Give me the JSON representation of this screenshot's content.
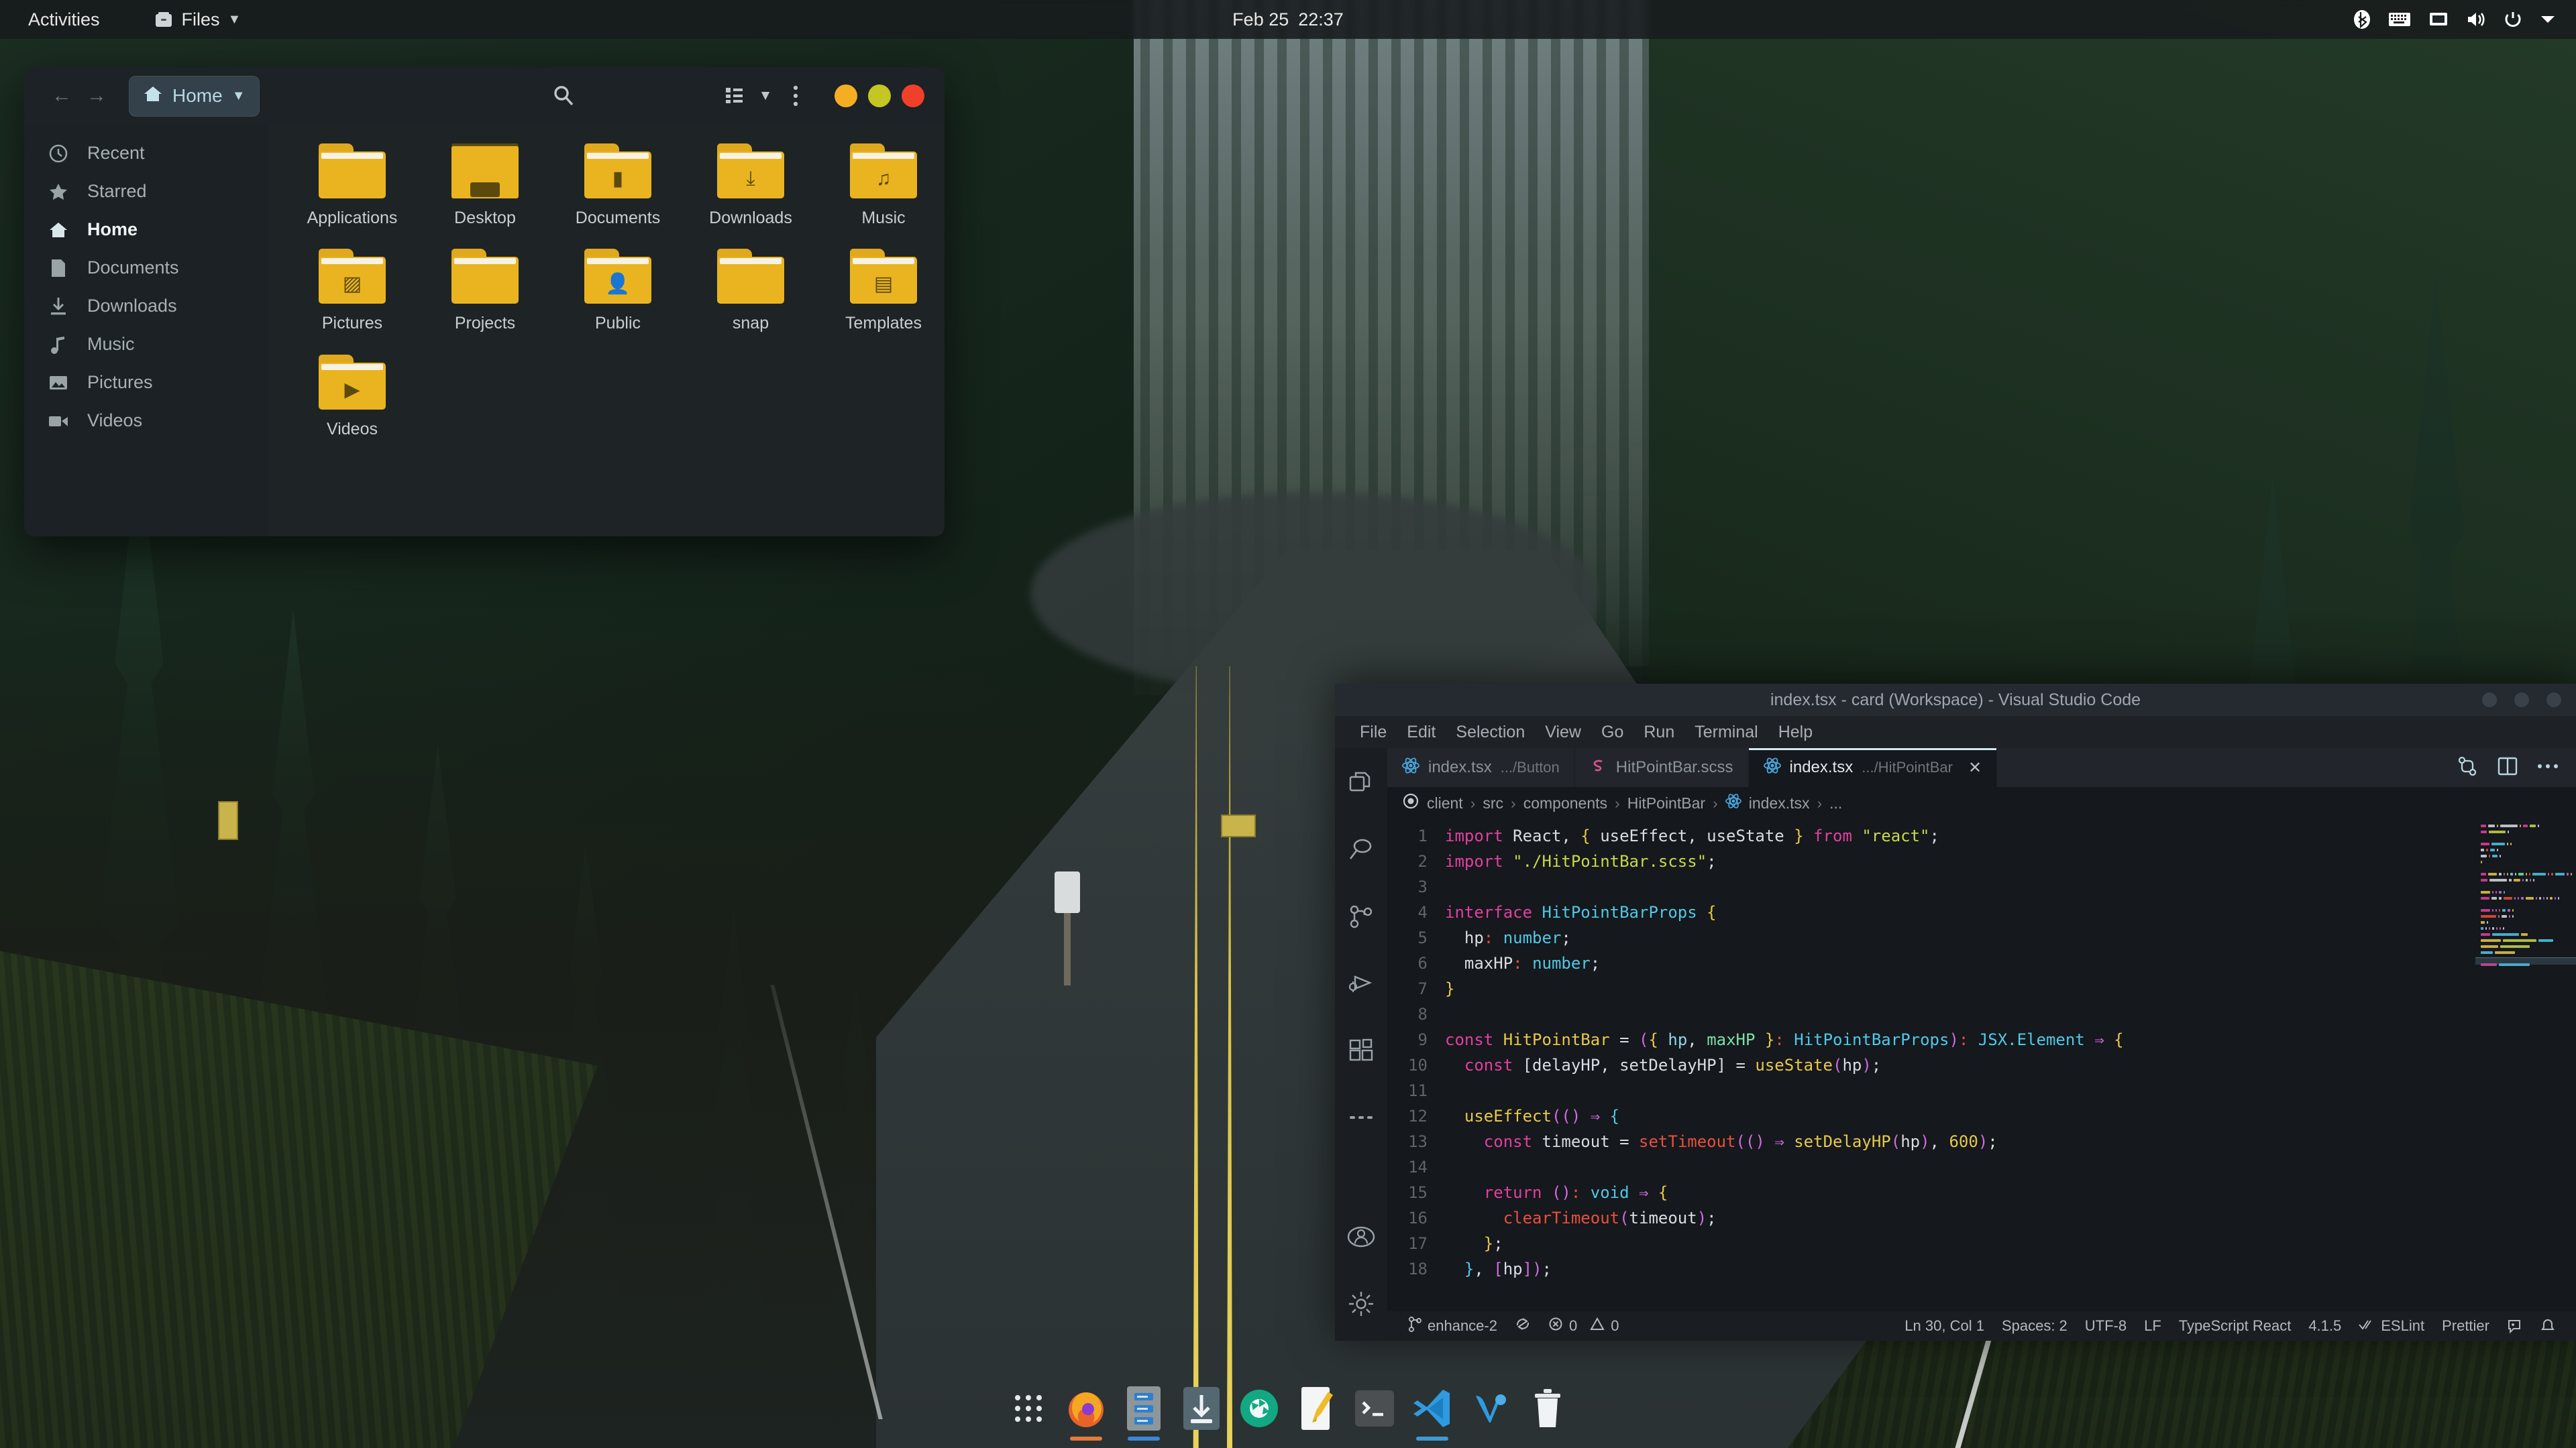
{
  "topbar": {
    "activities": "Activities",
    "app_name": "Files",
    "app_icon": "files-icon",
    "app_menu_arrow": "▼",
    "clock_date": "Feb 25",
    "clock_time": "22:37",
    "tray_icons": [
      "bluetooth-icon",
      "keyboard-icon",
      "display-icon",
      "volume-icon",
      "power-icon",
      "chevron-down-icon"
    ]
  },
  "files_window": {
    "header": {
      "back_arrow": "←",
      "forward_arrow": "→",
      "path_label": "Home",
      "path_home_icon": "home-icon",
      "path_dropdown": "▼",
      "search_icon": "search-icon",
      "view_icon": "list-view-icon",
      "view_dropdown": "▼",
      "menu_icon": "kebab-menu-icon",
      "window_controls": [
        {
          "name": "minimize-button",
          "color": "#f5ad23"
        },
        {
          "name": "maximize-button",
          "color": "#c3c623"
        },
        {
          "name": "close-button",
          "color": "#f0402a"
        }
      ]
    },
    "sidebar": {
      "items": [
        {
          "label": "Recent",
          "icon": "clock-icon",
          "active": false
        },
        {
          "label": "Starred",
          "icon": "star-icon",
          "active": false
        },
        {
          "label": "Home",
          "icon": "home-icon",
          "active": true
        },
        {
          "label": "Documents",
          "icon": "document-icon",
          "active": false
        },
        {
          "label": "Downloads",
          "icon": "download-icon",
          "active": false
        },
        {
          "label": "Music",
          "icon": "music-note-icon",
          "active": false
        },
        {
          "label": "Pictures",
          "icon": "image-icon",
          "active": false
        },
        {
          "label": "Videos",
          "icon": "video-camera-icon",
          "active": false
        }
      ]
    },
    "folders": [
      {
        "label": "Applications",
        "glyph": "",
        "variant": "plain"
      },
      {
        "label": "Desktop",
        "glyph": "",
        "variant": "desktop"
      },
      {
        "label": "Documents",
        "glyph": "▮",
        "variant": "plain"
      },
      {
        "label": "Downloads",
        "glyph": "⤓",
        "variant": "plain"
      },
      {
        "label": "Music",
        "glyph": "♫",
        "variant": "plain"
      },
      {
        "label": "Pictures",
        "glyph": "▨",
        "variant": "plain"
      },
      {
        "label": "Projects",
        "glyph": "",
        "variant": "plain"
      },
      {
        "label": "Public",
        "glyph": "👤",
        "variant": "plain"
      },
      {
        "label": "snap",
        "glyph": "",
        "variant": "plain"
      },
      {
        "label": "Templates",
        "glyph": "▤",
        "variant": "plain"
      },
      {
        "label": "Videos",
        "glyph": "▶",
        "variant": "plain"
      }
    ]
  },
  "vscode": {
    "title": "index.tsx - card (Workspace) - Visual Studio Code",
    "menus": [
      "File",
      "Edit",
      "Selection",
      "View",
      "Go",
      "Run",
      "Terminal",
      "Help"
    ],
    "activity_icons": [
      "explorer-icon",
      "search-icon",
      "source-control-icon",
      "run-and-debug-icon",
      "extensions-icon",
      "more-views-icon",
      "account-icon",
      "settings-gear-icon"
    ],
    "tabs": [
      {
        "name": "index.tsx",
        "sub": ".../Button",
        "icon": "react-icon",
        "active": false,
        "closable": false
      },
      {
        "name": "HitPointBar.scss",
        "sub": "",
        "icon": "sass-icon",
        "active": false,
        "closable": false
      },
      {
        "name": "index.tsx",
        "sub": ".../HitPointBar",
        "icon": "react-icon",
        "active": true,
        "closable": true,
        "close_label": "✕"
      }
    ],
    "editor_actions": [
      "diff-editor-icon",
      "split-editor-icon",
      "more-actions-icon"
    ],
    "breadcrumb": {
      "status_icon": "circle-outline-icon",
      "parts": [
        "client",
        "src",
        "components",
        "HitPointBar",
        "index.tsx",
        "..."
      ],
      "file_icon": "react-icon",
      "separator": "›"
    },
    "code": {
      "first_line_number": 1,
      "cursor_line_number": 30,
      "lines": [
        {
          "n": 1,
          "tokens": [
            {
              "t": "import",
              "c": "kw"
            },
            {
              "t": " React, ",
              "c": "pl"
            },
            {
              "t": "{",
              "c": "br1"
            },
            {
              "t": " useEffect, useState ",
              "c": "var"
            },
            {
              "t": "}",
              "c": "br1"
            },
            {
              "t": " from ",
              "c": "kw"
            },
            {
              "t": "\"react\"",
              "c": "str"
            },
            {
              "t": ";",
              "c": "pl"
            }
          ]
        },
        {
          "n": 2,
          "tokens": [
            {
              "t": "import ",
              "c": "kw"
            },
            {
              "t": "\"./HitPointBar.scss\"",
              "c": "str"
            },
            {
              "t": ";",
              "c": "pl"
            }
          ]
        },
        {
          "n": 3,
          "tokens": []
        },
        {
          "n": 4,
          "tokens": [
            {
              "t": "interface ",
              "c": "kw"
            },
            {
              "t": "HitPointBarProps",
              "c": "type"
            },
            {
              "t": " ",
              "c": "pl"
            },
            {
              "t": "{",
              "c": "br1"
            }
          ]
        },
        {
          "n": 5,
          "tokens": [
            {
              "t": "  hp",
              "c": "prop"
            },
            {
              "t": ": ",
              "c": "op"
            },
            {
              "t": "number",
              "c": "type"
            },
            {
              "t": ";",
              "c": "pl"
            }
          ]
        },
        {
          "n": 6,
          "tokens": [
            {
              "t": "  maxHP",
              "c": "prop"
            },
            {
              "t": ": ",
              "c": "op"
            },
            {
              "t": "number",
              "c": "type"
            },
            {
              "t": ";",
              "c": "pl"
            }
          ]
        },
        {
          "n": 7,
          "tokens": [
            {
              "t": "}",
              "c": "br1"
            }
          ]
        },
        {
          "n": 8,
          "tokens": []
        },
        {
          "n": 9,
          "tokens": [
            {
              "t": "const ",
              "c": "kw"
            },
            {
              "t": "HitPointBar",
              "c": "fnname"
            },
            {
              "t": " = ",
              "c": "pl"
            },
            {
              "t": "(",
              "c": "br2"
            },
            {
              "t": "{",
              "c": "br1"
            },
            {
              "t": " hp",
              "c": "param"
            },
            {
              "t": ", ",
              "c": "pl"
            },
            {
              "t": "maxHP ",
              "c": "param2"
            },
            {
              "t": "}",
              "c": "br1"
            },
            {
              "t": ": ",
              "c": "op"
            },
            {
              "t": "HitPointBarProps",
              "c": "type"
            },
            {
              "t": ")",
              "c": "br2"
            },
            {
              "t": ": ",
              "c": "op"
            },
            {
              "t": "JSX.Element",
              "c": "type"
            },
            {
              "t": " ⇒ ",
              "c": "arrow"
            },
            {
              "t": "{",
              "c": "br1"
            }
          ]
        },
        {
          "n": 10,
          "tokens": [
            {
              "t": "  const ",
              "c": "kw"
            },
            {
              "t": "[delayHP, setDelayHP]",
              "c": "var"
            },
            {
              "t": " = ",
              "c": "pl"
            },
            {
              "t": "useState",
              "c": "fnname"
            },
            {
              "t": "(",
              "c": "br2"
            },
            {
              "t": "hp",
              "c": "var"
            },
            {
              "t": ")",
              "c": "br2"
            },
            {
              "t": ";",
              "c": "pl"
            }
          ]
        },
        {
          "n": 11,
          "tokens": []
        },
        {
          "n": 12,
          "tokens": [
            {
              "t": "  useEffect",
              "c": "fnname"
            },
            {
              "t": "((",
              "c": "br2"
            },
            {
              "t": ")",
              "c": "br2"
            },
            {
              "t": " ⇒ ",
              "c": "arrow"
            },
            {
              "t": "{",
              "c": "br3"
            }
          ]
        },
        {
          "n": 13,
          "tokens": [
            {
              "t": "    const ",
              "c": "kw"
            },
            {
              "t": "timeout",
              "c": "var"
            },
            {
              "t": " = ",
              "c": "pl"
            },
            {
              "t": "setTimeout",
              "c": "fnred"
            },
            {
              "t": "((",
              "c": "br2"
            },
            {
              "t": ")",
              "c": "br2"
            },
            {
              "t": " ⇒ ",
              "c": "arrow"
            },
            {
              "t": "setDelayHP",
              "c": "fnname"
            },
            {
              "t": "(",
              "c": "br2"
            },
            {
              "t": "hp",
              "c": "var"
            },
            {
              "t": ")",
              "c": "br2"
            },
            {
              "t": ", ",
              "c": "pl"
            },
            {
              "t": "600",
              "c": "num"
            },
            {
              "t": ")",
              "c": "br2"
            },
            {
              "t": ";",
              "c": "pl"
            }
          ]
        },
        {
          "n": 14,
          "tokens": []
        },
        {
          "n": 15,
          "tokens": [
            {
              "t": "    return ",
              "c": "kw"
            },
            {
              "t": "(",
              "c": "br2"
            },
            {
              "t": ")",
              "c": "br2"
            },
            {
              "t": ": ",
              "c": "op"
            },
            {
              "t": "void",
              "c": "type"
            },
            {
              "t": " ⇒ ",
              "c": "arrow"
            },
            {
              "t": "{",
              "c": "br1"
            }
          ]
        },
        {
          "n": 16,
          "tokens": [
            {
              "t": "      clearTimeout",
              "c": "fnred"
            },
            {
              "t": "(",
              "c": "br2"
            },
            {
              "t": "timeout",
              "c": "var"
            },
            {
              "t": ")",
              "c": "br2"
            },
            {
              "t": ";",
              "c": "pl"
            }
          ]
        },
        {
          "n": 17,
          "tokens": [
            {
              "t": "    }",
              "c": "br1"
            },
            {
              "t": ";",
              "c": "pl"
            }
          ]
        },
        {
          "n": 18,
          "tokens": [
            {
              "t": "  }",
              "c": "br3"
            },
            {
              "t": ", ",
              "c": "pl"
            },
            {
              "t": "[",
              "c": "br4"
            },
            {
              "t": "hp",
              "c": "var"
            },
            {
              "t": "]",
              "c": "br4"
            },
            {
              "t": ")",
              "c": "br2"
            },
            {
              "t": ";",
              "c": "pl"
            }
          ]
        }
      ],
      "colors": {
        "keyword": "#e040a0",
        "type": "#4ec9e8",
        "string": "#c8d84a",
        "function": "#e8c84a",
        "function_red": "#e8503c",
        "number": "#e8c84a",
        "bracket_yellow": "#e8c84a",
        "bracket_pink": "#d06ce0",
        "bracket_blue": "#4ec9e8",
        "variable": "#d8dde2",
        "property": "#d8dde2",
        "operator": "#e8503c",
        "line_number": "#5d646b"
      }
    },
    "status_bar": {
      "branch_icon": "source-control-branch-icon",
      "branch": "enhance-2",
      "sync_icon": "sync-icon",
      "error_icon": "error-icon",
      "errors": "0",
      "warning_icon": "warning-icon",
      "warnings": "0",
      "cursor_position": "Ln 30, Col 1",
      "indentation": "Spaces: 2",
      "encoding": "UTF-8",
      "eol": "LF",
      "language": "TypeScript React",
      "version": "4.1.5",
      "eslint_icon": "check-icon",
      "eslint": "ESLint",
      "prettier": "Prettier",
      "feedback_icon": "feedback-icon",
      "bell_icon": "bell-icon"
    }
  },
  "dock": {
    "items": [
      {
        "name": "show-applications",
        "icon": "app-grid-icon",
        "indicator": ""
      },
      {
        "name": "firefox",
        "icon": "firefox-icon",
        "indicator": "#e8793a"
      },
      {
        "name": "files",
        "icon": "files-icon",
        "indicator": "#3a86d8"
      },
      {
        "name": "software-installer",
        "icon": "software-install-icon",
        "indicator": ""
      },
      {
        "name": "shutter",
        "icon": "camera-shutter-icon",
        "indicator": ""
      },
      {
        "name": "text-editor",
        "icon": "text-editor-icon",
        "indicator": ""
      },
      {
        "name": "terminal",
        "icon": "terminal-icon",
        "indicator": ""
      },
      {
        "name": "visual-studio-code",
        "icon": "vscode-icon",
        "indicator": "#3a9ad8"
      },
      {
        "name": "vivaldi-browser",
        "icon": "vivaldi-icon",
        "indicator": ""
      },
      {
        "name": "trash",
        "icon": "trash-icon",
        "indicator": ""
      }
    ]
  }
}
